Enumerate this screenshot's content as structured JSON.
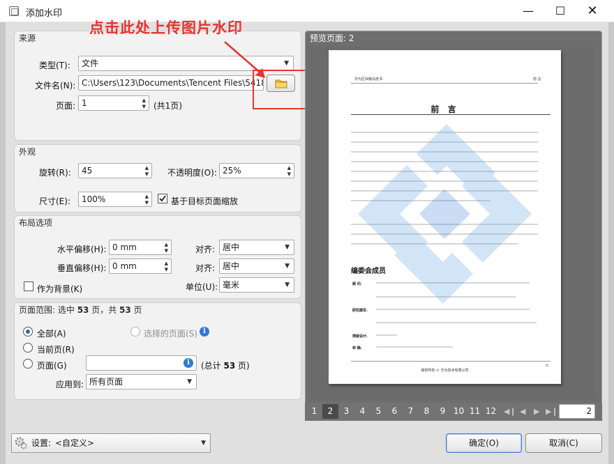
{
  "window": {
    "title": "添加水印",
    "annotation": "点击此处上传图片水印"
  },
  "source": {
    "title": "来源",
    "type_label": "类型(T):",
    "type_value": "文件",
    "filename_label": "文件名(N):",
    "filename_value": "C:\\Users\\123\\Documents\\Tencent Files\\5418",
    "page_label": "页面:",
    "page_value": "1",
    "page_total": "(共1页)"
  },
  "appearance": {
    "title": "外观",
    "rotation_label": "旋转(R):",
    "rotation_value": "45",
    "opacity_label": "不透明度(O):",
    "opacity_value": "25%",
    "size_label": "尺寸(E):",
    "size_value": "100%",
    "scale_label": "基于目标页面缩放",
    "scale_checked": true
  },
  "layout": {
    "title": "布局选项",
    "h_offset_label": "水平偏移(H):",
    "h_offset_value": "0 mm",
    "h_align_label": "对齐:",
    "h_align_value": "居中",
    "v_offset_label": "垂直偏移(H):",
    "v_offset_value": "0 mm",
    "v_align_label": "对齐:",
    "v_align_value": "居中",
    "background_label": "作为背景(K)",
    "background_checked": false,
    "unit_label": "单位(U):",
    "unit_value": "毫米"
  },
  "range": {
    "title_prefix": "页面范围: 选中 ",
    "selected": "53",
    "title_mid": " 页，共 ",
    "total": "53",
    "title_suffix": " 页",
    "all_label": "全部(A)",
    "selected_pages_label": "选择的页面(S)",
    "current_label": "当前页(R)",
    "pages_label": "页面(G)",
    "pages_value": "",
    "total_prefix": "(总计 ",
    "total_count": "53",
    "total_suffix": " 页)",
    "apply_label": "应用到:",
    "apply_value": "所有页面"
  },
  "preview": {
    "title": "预览页面: 2",
    "doc_header_left": "华为区块链白皮书",
    "doc_header_right": "前 言",
    "doc_heading": "前 言",
    "doc_section": "编委会成员",
    "doc_roles": [
      "顾 问:",
      "研究撰写:",
      "排版设计:",
      "审 稿:"
    ],
    "doc_footer": "版权所有 © 华为技术有限公司",
    "doc_page_num": "II",
    "pages": [
      "1",
      "2",
      "3",
      "4",
      "5",
      "6",
      "7",
      "8",
      "9",
      "10",
      "11",
      "12"
    ],
    "current_page": "2",
    "page_input": "2"
  },
  "footer": {
    "settings_label": "设置:",
    "settings_value": "<自定义>",
    "ok": "确定(O)",
    "cancel": "取消(C)"
  },
  "colors": {
    "accent_red": "#e8332f",
    "watermark_blue": "#4f9be0",
    "page_selected": "#4a4a4a",
    "pager_bg": "#737373"
  }
}
